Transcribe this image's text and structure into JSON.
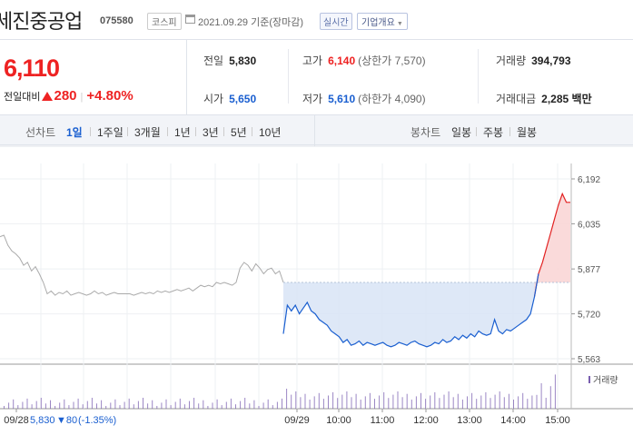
{
  "header": {
    "company_name": "세진중공업",
    "stock_code": "075580",
    "market": "코스피",
    "date_text": "2021.09.29 기준(장마감)",
    "realtime_label": "실시간",
    "corp_info_label": "기업개요"
  },
  "price": {
    "current": "6,110",
    "change_label": "전일대비",
    "change_amount": "280",
    "change_rate": "+4.80%"
  },
  "stats": {
    "prev_close_label": "전일",
    "prev_close": "5,830",
    "high_label": "고가",
    "high": "6,140",
    "upper_limit": "(상한가 7,570)",
    "volume_label": "거래량",
    "volume": "394,793",
    "open_label": "시가",
    "open": "5,650",
    "low_label": "저가",
    "low": "5,610",
    "lower_limit": "(하한가 4,090)",
    "trade_value_label": "거래대금",
    "trade_value": "2,285 백만"
  },
  "tabs": {
    "line_chart_label": "선차트",
    "line_periods": [
      "1일",
      "1주일",
      "3개월",
      "1년",
      "3년",
      "5년",
      "10년"
    ],
    "active": "1일",
    "candle_chart_label": "봉차트",
    "candle_periods": [
      "일봉",
      "주봉",
      "월봉"
    ]
  },
  "colors": {
    "up": "#e22222",
    "down": "#1a5fd0",
    "prev_day_line": "#aaaaaa",
    "fill_down": "#d8e4f6",
    "fill_up": "#f9d6d6",
    "volume_bar": "#7a5fb0"
  },
  "chart_data": {
    "type": "line",
    "y_ticks": [
      "6,192",
      "6,035",
      "5,877",
      "5,720",
      "5,563"
    ],
    "ylim": [
      5563,
      6192
    ],
    "reference_price": 5830,
    "x_ticks": [
      "09/28",
      "09/29",
      "10:00",
      "11:00",
      "12:00",
      "13:00",
      "14:00",
      "15:00"
    ],
    "prev_day": [
      5990,
      5995,
      5960,
      5940,
      5930,
      5915,
      5890,
      5900,
      5870,
      5885,
      5860,
      5830,
      5790,
      5800,
      5785,
      5795,
      5790,
      5800,
      5785,
      5790,
      5795,
      5790,
      5785,
      5790,
      5800,
      5790,
      5795,
      5785,
      5790,
      5795,
      5790,
      5790,
      5790,
      5790,
      5785,
      5790,
      5795,
      5790,
      5795,
      5790,
      5800,
      5795,
      5800,
      5795,
      5800,
      5805,
      5800,
      5805,
      5810,
      5800,
      5810,
      5820,
      5815,
      5820,
      5815,
      5830,
      5825,
      5830,
      5825,
      5820,
      5830,
      5880,
      5900,
      5890,
      5870,
      5895,
      5880,
      5860,
      5875,
      5880,
      5860,
      5870,
      5830
    ],
    "today": [
      5650,
      5750,
      5730,
      5750,
      5720,
      5740,
      5760,
      5730,
      5720,
      5700,
      5690,
      5680,
      5660,
      5650,
      5640,
      5620,
      5630,
      5610,
      5615,
      5625,
      5610,
      5620,
      5615,
      5610,
      5615,
      5620,
      5610,
      5605,
      5610,
      5620,
      5615,
      5610,
      5620,
      5625,
      5615,
      5610,
      5605,
      5610,
      5620,
      5615,
      5630,
      5620,
      5625,
      5640,
      5630,
      5645,
      5635,
      5650,
      5640,
      5660,
      5650,
      5645,
      5650,
      5700,
      5660,
      5650,
      5665,
      5660,
      5670,
      5680,
      5690,
      5700,
      5720,
      5780,
      5860,
      5900,
      5950,
      6000,
      6050,
      6100,
      6140,
      6110,
      6110
    ],
    "volume_label": "거래량",
    "summary": {
      "date": "09/28",
      "price": "5,830",
      "change": "▼80",
      "rate": "(-1.35%)"
    }
  }
}
